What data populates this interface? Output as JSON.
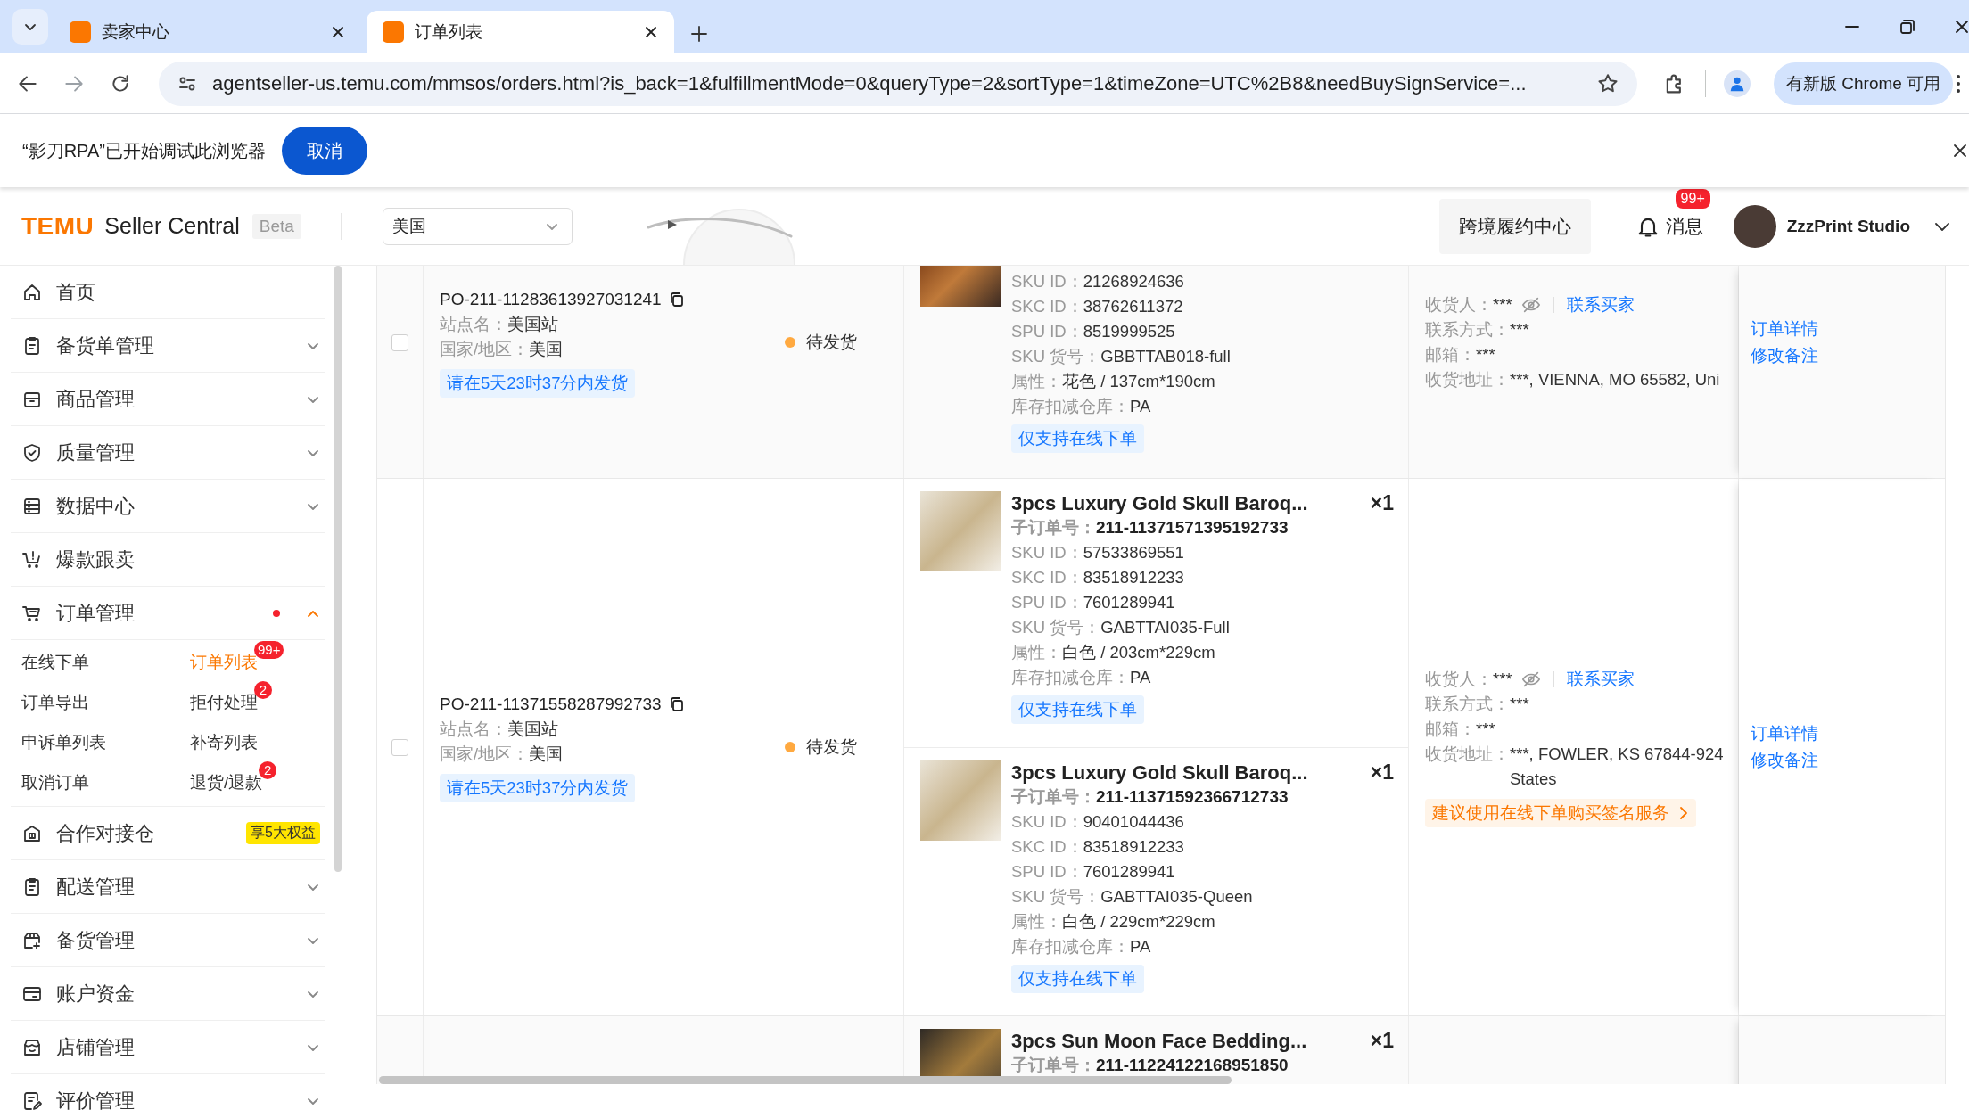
{
  "browser": {
    "tabs": [
      {
        "title": "卖家中心",
        "selected": false
      },
      {
        "title": "订单列表",
        "selected": true
      }
    ],
    "url": "agentseller-us.temu.com/mmsos/orders.html?is_back=1&fulfillmentMode=0&queryType=2&sortType=1&timeZone=UTC%2B8&needBuySignService=...",
    "update_button": "有新版 Chrome 可用"
  },
  "infobar": {
    "message": "“影刀RPA”已开始调试此浏览器",
    "cancel_button": "取消"
  },
  "header": {
    "logo": "TEMU",
    "product_name": "Seller Central",
    "beta_tag": "Beta",
    "region_select": "美国",
    "fulfillment_button": "跨境履约中心",
    "messages": "消息",
    "messages_badge": "99+",
    "account_name": "ZzzPrint Studio"
  },
  "sidebar": {
    "items": [
      {
        "label": "首页",
        "alert": false
      },
      {
        "label": "备货单管理",
        "alert": false,
        "expanded": false
      },
      {
        "label": "商品管理",
        "alert": false,
        "expanded": false
      },
      {
        "label": "质量管理",
        "alert": false,
        "expanded": false
      },
      {
        "label": "数据中心",
        "alert": false,
        "expanded": false
      },
      {
        "label": "爆款跟卖",
        "alert": false
      },
      {
        "label": "订单管理",
        "alert": true,
        "expanded": true,
        "children": [
          {
            "label": "在线下单",
            "selected": false
          },
          {
            "label": "订单列表",
            "selected": true,
            "badge": "99+"
          },
          {
            "label": "订单导出",
            "selected": false
          },
          {
            "label": "拒付处理",
            "selected": false,
            "badge": "2"
          },
          {
            "label": "申诉单列表",
            "selected": false
          },
          {
            "label": "补寄列表",
            "selected": false
          },
          {
            "label": "取消订单",
            "selected": false
          },
          {
            "label": "退货/退款",
            "selected": false,
            "badge": "2"
          }
        ]
      },
      {
        "label": "合作对接仓",
        "alert": false,
        "tag": "享5大权益"
      },
      {
        "label": "配送管理",
        "alert": false,
        "expanded": false
      },
      {
        "label": "备货管理",
        "alert": false,
        "expanded": false
      },
      {
        "label": "账户资金",
        "alert": false,
        "expanded": false
      },
      {
        "label": "店铺管理",
        "alert": false,
        "expanded": false
      },
      {
        "label": "评价管理",
        "alert": false,
        "expanded": false
      }
    ]
  },
  "orders": [
    {
      "checked": false,
      "po": "PO-211-11283613927031241",
      "site_label": "站点名：",
      "site": "美国站",
      "region_label": "国家/地区：",
      "region": "美国",
      "deadline": "请在5天23时37分内发货",
      "status": {
        "text": "待发货",
        "color": "#ffa940"
      },
      "products": [
        {
          "fields": [
            {
              "label": "SKU ID：",
              "value": "21268924636"
            },
            {
              "label": "SKC ID：",
              "value": "38762611372"
            },
            {
              "label": "SPU ID：",
              "value": "8519999525"
            },
            {
              "label": "SKU 货号：",
              "value": "GBBTTAB018-full"
            },
            {
              "label": "属性：",
              "value": "花色 / 137cm*190cm"
            },
            {
              "label": "库存扣减仓库：",
              "value": "PA"
            }
          ],
          "tag": "仅支持在线下单"
        }
      ],
      "buyer": {
        "consignee_label": "收货人：",
        "consignee": "***",
        "contact_link": "联系买家",
        "phone_label": "联系方式：",
        "phone": "***",
        "email_label": "邮箱：",
        "email": "***",
        "address_label": "收货地址：",
        "address_lines": [
          "***, VIENNA, MO 65582, Uni"
        ]
      },
      "actions": [
        "订单详情",
        "修改备注"
      ]
    },
    {
      "checked": false,
      "po": "PO-211-11371558287992733",
      "site_label": "站点名：",
      "site": "美国站",
      "region_label": "国家/地区：",
      "region": "美国",
      "deadline": "请在5天23时37分内发货",
      "status": {
        "text": "待发货",
        "color": "#ffa940"
      },
      "products": [
        {
          "title": "3pcs Luxury Gold Skull Baroq...",
          "qty": "×1",
          "sub_order_label": "子订单号：",
          "sub_order": "211-11371571395192733",
          "fields": [
            {
              "label": "SKU ID：",
              "value": "57533869551"
            },
            {
              "label": "SKC ID：",
              "value": "83518912233"
            },
            {
              "label": "SPU ID：",
              "value": "7601289941"
            },
            {
              "label": "SKU 货号：",
              "value": "GABTTAI035-Full"
            },
            {
              "label": "属性：",
              "value": "白色 / 203cm*229cm"
            },
            {
              "label": "库存扣减仓库：",
              "value": "PA"
            }
          ],
          "tag": "仅支持在线下单"
        },
        {
          "title": "3pcs Luxury Gold Skull Baroq...",
          "qty": "×1",
          "sub_order_label": "子订单号：",
          "sub_order": "211-11371592366712733",
          "fields": [
            {
              "label": "SKU ID：",
              "value": "90401044436"
            },
            {
              "label": "SKC ID：",
              "value": "83518912233"
            },
            {
              "label": "SPU ID：",
              "value": "7601289941"
            },
            {
              "label": "SKU 货号：",
              "value": "GABTTAI035-Queen"
            },
            {
              "label": "属性：",
              "value": "白色 / 229cm*229cm"
            },
            {
              "label": "库存扣减仓库：",
              "value": "PA"
            }
          ],
          "tag": "仅支持在线下单"
        }
      ],
      "buyer": {
        "consignee_label": "收货人：",
        "consignee": "***",
        "contact_link": "联系买家",
        "phone_label": "联系方式：",
        "phone": "***",
        "email_label": "邮箱：",
        "email": "***",
        "address_label": "收货地址：",
        "address_lines": [
          "***, FOWLER, KS 67844-924",
          "States"
        ],
        "service_tag": "建议使用在线下单购买签名服务"
      },
      "actions": [
        "订单详情",
        "修改备注"
      ]
    },
    {
      "products": [
        {
          "title": "3pcs Sun Moon Face Bedding...",
          "qty": "×1",
          "sub_order_label": "子订单号：",
          "sub_order": "211-11224122168951850"
        }
      ]
    }
  ]
}
